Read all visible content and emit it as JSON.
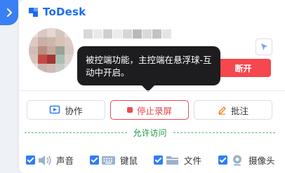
{
  "app": {
    "name": "ToDesk"
  },
  "session": {
    "tooltip_text": "被控端功能，主控端在悬浮球-互动中开启。",
    "disconnect_label": "断开"
  },
  "actions": {
    "collab_label": "协作",
    "stop_record_label": "停止录屏",
    "annotate_label": "批注"
  },
  "permissions": {
    "title": "允许访问",
    "items": [
      {
        "label": "声音",
        "icon": "speaker-icon",
        "checked": true
      },
      {
        "label": "键鼠",
        "icon": "keyboard-icon",
        "checked": true
      },
      {
        "label": "文件",
        "icon": "folder-icon",
        "checked": true
      },
      {
        "label": "摄像头",
        "icon": "webcam-icon",
        "checked": true
      }
    ]
  },
  "colors": {
    "accent": "#1e6bf0",
    "danger": "#f5474d",
    "success": "#1d9a45",
    "tooltip_bg": "#1d1d1f"
  }
}
